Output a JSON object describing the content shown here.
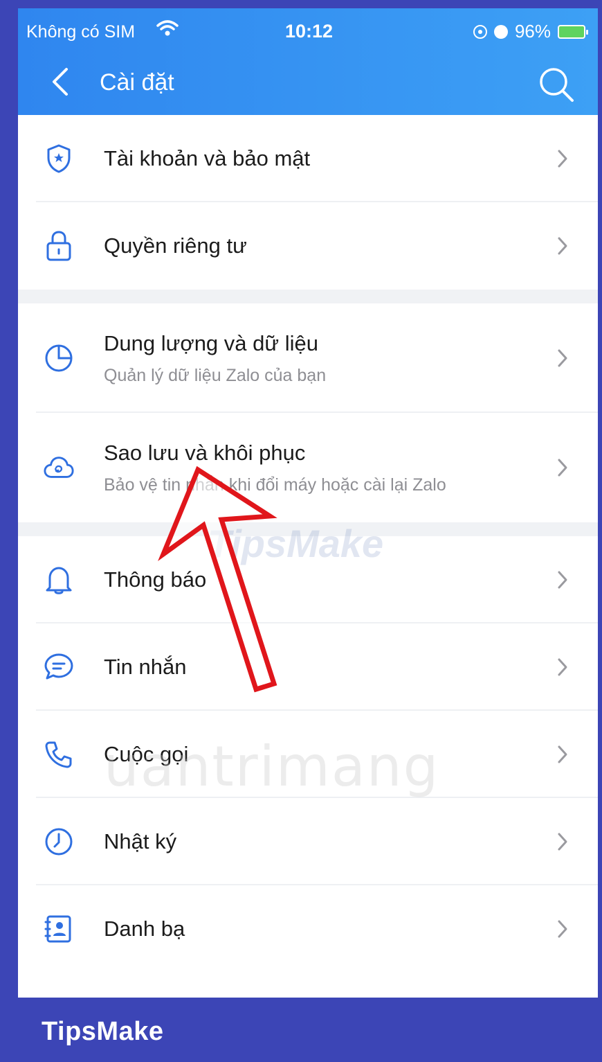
{
  "status_bar": {
    "carrier": "Không có SIM",
    "time": "10:12",
    "battery": "96%"
  },
  "header": {
    "title": "Cài đặt"
  },
  "settings": {
    "items": [
      {
        "label": "Tài khoản và bảo mật",
        "icon": "shield-icon"
      },
      {
        "label": "Quyền riêng tư",
        "icon": "lock-icon"
      },
      {
        "label": "Dung lượng và dữ liệu",
        "subtitle": "Quản lý dữ liệu Zalo của bạn",
        "icon": "pie-chart-icon"
      },
      {
        "label": "Sao lưu và khôi phục",
        "subtitle": "Bảo vệ tin nhắn khi đổi máy hoặc cài lại Zalo",
        "icon": "cloud-sync-icon"
      },
      {
        "label": "Thông báo",
        "icon": "bell-icon"
      },
      {
        "label": "Tin nhắn",
        "icon": "message-icon"
      },
      {
        "label": "Cuộc gọi",
        "icon": "phone-icon"
      },
      {
        "label": "Nhật ký",
        "icon": "clock-icon"
      },
      {
        "label": "Danh bạ",
        "icon": "contacts-icon"
      }
    ]
  },
  "watermark": {
    "brand": "TipsMake",
    "overlay_1": "TipsMake",
    "overlay_2": "uantrimang"
  },
  "colors": {
    "header_blue": "#3a96f2",
    "icon_blue": "#2f6fe0",
    "frame": "#3c45b6",
    "arrow_red": "#e0161b"
  }
}
